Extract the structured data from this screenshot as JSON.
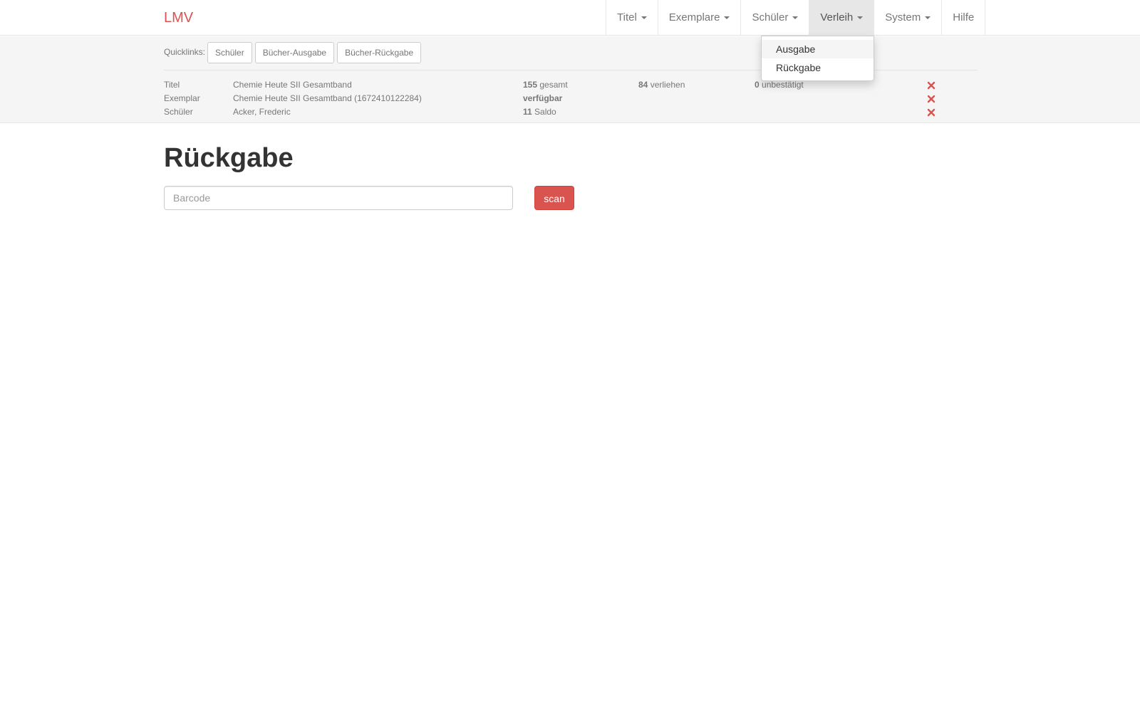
{
  "navbar": {
    "brand": "LMV",
    "items": [
      {
        "label": "Titel",
        "dropdown": true,
        "active": false
      },
      {
        "label": "Exemplare",
        "dropdown": true,
        "active": false
      },
      {
        "label": "Schüler",
        "dropdown": true,
        "active": false
      },
      {
        "label": "Verleih",
        "dropdown": true,
        "active": true
      },
      {
        "label": "System",
        "dropdown": true,
        "active": false
      },
      {
        "label": "Hilfe",
        "dropdown": false,
        "active": false
      }
    ],
    "dropdown_open": {
      "parent": "Verleih",
      "items": [
        "Ausgabe",
        "Rückgabe"
      ],
      "hovered": "Ausgabe"
    }
  },
  "quicklinks": {
    "label": "Quicklinks:",
    "buttons": [
      "Schüler",
      "Bücher-Ausgabe",
      "Bücher-Rückgabe"
    ]
  },
  "info": {
    "titel": {
      "label": "Titel",
      "value": "Chemie Heute SII Gesamtband",
      "gesamt_count": "155",
      "gesamt_label": "gesamt",
      "verliehen_count": "84",
      "verliehen_label": "verliehen",
      "unbestaetigt_count": "0",
      "unbestaetigt_label": "unbestätigt"
    },
    "exemplar": {
      "label": "Exemplar",
      "value": "Chemie Heute SII Gesamtband (1672410122284)",
      "status": "verfügbar"
    },
    "schueler": {
      "label": "Schüler",
      "value": "Acker, Frederic",
      "saldo_count": "11",
      "saldo_label": "Saldo"
    }
  },
  "main": {
    "title": "Rückgabe",
    "barcode_placeholder": "Barcode",
    "barcode_value": "",
    "scan_label": "scan"
  },
  "colors": {
    "brand": "#d9534f",
    "danger": "#d9534f",
    "infobar_bg": "#f5f5f5",
    "nav_active_bg": "#e7e7e7"
  }
}
